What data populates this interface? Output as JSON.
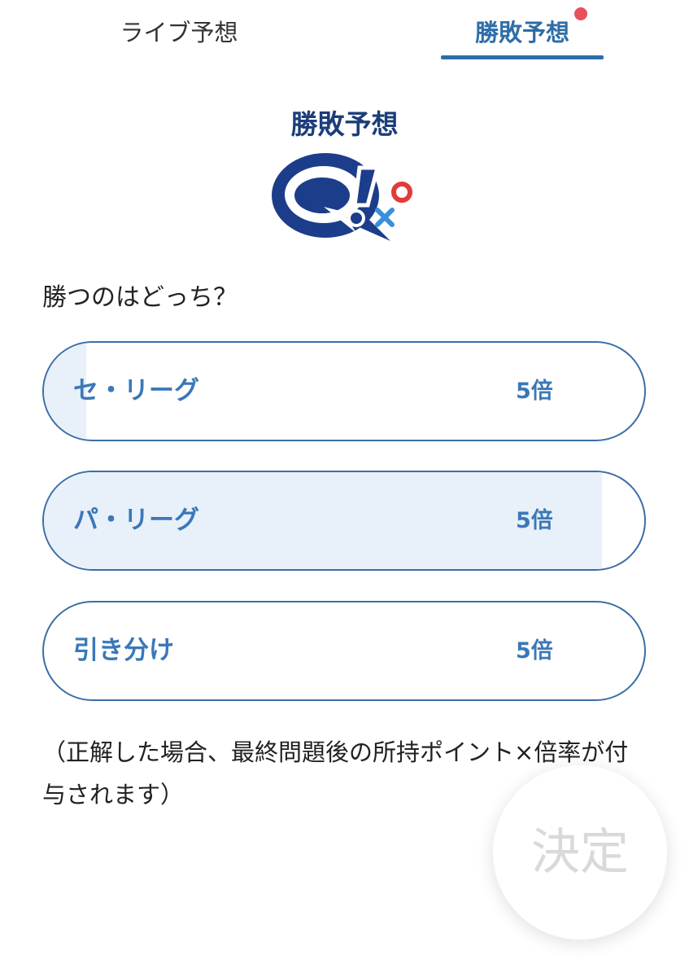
{
  "tabs": {
    "live_label": "ライブ予想",
    "result_label": "勝敗予想"
  },
  "heading": "勝敗予想",
  "question": "勝つのはどっち？",
  "options": [
    {
      "label": "セ・リーグ",
      "odds": "5倍",
      "fill_percent": 7
    },
    {
      "label": "パ・リーグ",
      "odds": "5倍",
      "fill_percent": 93
    },
    {
      "label": "引き分け",
      "odds": "5倍",
      "fill_percent": 0
    }
  ],
  "note": "（正解した場合、最終問題後の所持ポイント×倍率が付与されます）",
  "decide_label": "決定",
  "colors": {
    "accent": "#2e6da8",
    "heading": "#1c3d7a",
    "option_text": "#3a78b8",
    "option_fill": "#e8f0f9",
    "notification": "#e8505b",
    "disabled_text": "#d9d9d9"
  },
  "icons": {
    "logo": "quiz-q-logo-icon"
  }
}
